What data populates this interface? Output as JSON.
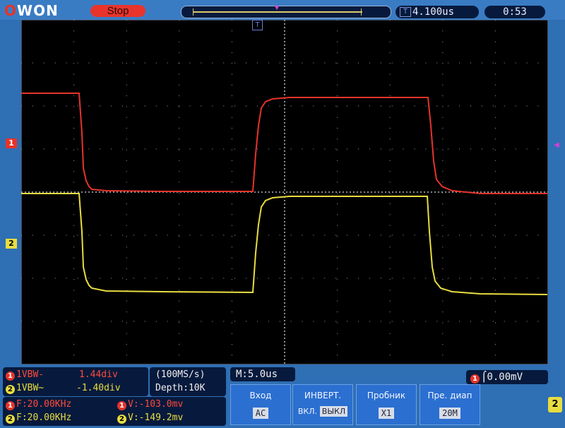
{
  "header": {
    "brand": "OWON",
    "run_state": "Stop",
    "trigger_delay": "4.100us",
    "clock": "0:53",
    "trigger_marker": "T"
  },
  "channels": {
    "ch1_marker": "1",
    "ch2_marker": "2"
  },
  "info": {
    "ch1": {
      "id": "1",
      "coupling": "1VBW-",
      "position": "1.44div",
      "freq": "F:20.00KHz",
      "vmeas": "V:-103.0mv"
    },
    "ch2": {
      "id": "2",
      "coupling": "1VBW~",
      "position": "-1.40div",
      "freq": "F:20.00KHz",
      "vmeas": "V:-149.2mv"
    },
    "sample_rate": "(100MS/s)",
    "depth": "Depth:10K",
    "timebase": "M:5.0us",
    "trigger": {
      "channel": "1",
      "level": "0.00mV"
    }
  },
  "menu": {
    "input": {
      "title": "Вход",
      "value": "AC"
    },
    "invert": {
      "title": "ИНВЕРТ.",
      "on": "ВКЛ.",
      "off": "ВЫКЛ"
    },
    "probe": {
      "title": "Пробник",
      "value": "X1"
    },
    "bandwidth": {
      "title": "Пре. диап",
      "value": "20M"
    },
    "side_channel": "2"
  },
  "colors": {
    "ch1": "#e6332a",
    "ch2": "#e8dd40",
    "screen": "#000000",
    "frame": "#2f6fb4"
  }
}
